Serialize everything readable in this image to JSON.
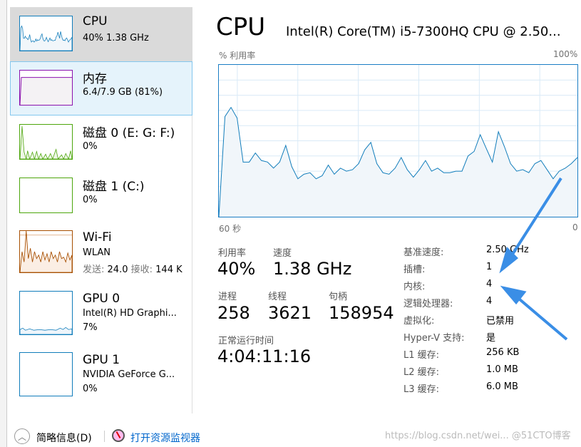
{
  "sidebar": {
    "items": [
      {
        "title": "CPU",
        "sub": "40% 1.38 GHz",
        "color": "#117dbb",
        "state": "selected"
      },
      {
        "title": "内存",
        "sub": "6.4/7.9 GB (81%)",
        "color": "#8b12ae",
        "state": "hover"
      },
      {
        "title": "磁盘 0 (E: G: F:)",
        "sub": "0%",
        "color": "#4da60c"
      },
      {
        "title": "磁盘 1 (C:)",
        "sub": "0%",
        "color": "#4da60c"
      },
      {
        "title": "Wi-Fi",
        "sub": "WLAN",
        "send_label": "发送:",
        "send": "24.0",
        "recv_label": "接收:",
        "recv": "144 K",
        "color": "#a74f01"
      },
      {
        "title": "GPU 0",
        "sub": "Intel(R) HD Graphi...",
        "sub2": "7%",
        "color": "#117dbb"
      },
      {
        "title": "GPU 1",
        "sub": "NVIDIA GeForce G...",
        "sub2": "0%",
        "color": "#117dbb"
      }
    ]
  },
  "main": {
    "title": "CPU",
    "model": "Intel(R) Core(TM) i5-7300HQ CPU @ 2.50...",
    "graph_label": "% 利用率",
    "graph_max": "100%",
    "graph_left": "60 秒",
    "graph_right": "0",
    "stats": {
      "util_label": "利用率",
      "util": "40%",
      "speed_label": "速度",
      "speed": "1.38 GHz",
      "proc_label": "进程",
      "proc": "258",
      "thread_label": "线程",
      "thread": "3621",
      "handle_label": "句柄",
      "handle": "158954",
      "uptime_label": "正常运行时间",
      "uptime": "4:04:11:16"
    },
    "specs": [
      {
        "k": "基准速度:",
        "v": "2.50 GHz"
      },
      {
        "k": "插槽:",
        "v": "1"
      },
      {
        "k": "内核:",
        "v": "4"
      },
      {
        "k": "逻辑处理器:",
        "v": "4"
      },
      {
        "k": "虚拟化:",
        "v": "已禁用"
      },
      {
        "k": "Hyper-V 支持:",
        "v": "是"
      },
      {
        "k": "L1 缓存:",
        "v": "256 KB"
      },
      {
        "k": "L2 缓存:",
        "v": "1.0 MB"
      },
      {
        "k": "L3 缓存:",
        "v": "6.0 MB"
      }
    ]
  },
  "footer": {
    "summary": "简略信息(D)",
    "monitor": "打开资源监视器"
  },
  "watermark": "https://blog.csdn.net/wei... @51CTO博客",
  "chart_data": {
    "type": "area",
    "ylim": [
      0,
      100
    ],
    "xlabel": "60 秒",
    "ylabel": "% 利用率",
    "grid": true,
    "values": [
      0,
      66,
      72,
      65,
      36,
      36,
      42,
      37,
      36,
      32,
      36,
      47,
      33,
      25,
      28,
      29,
      25,
      27,
      34,
      28,
      32,
      30,
      31,
      35,
      44,
      49,
      35,
      29,
      28,
      32,
      39,
      31,
      26,
      31,
      37,
      30,
      32,
      29,
      29,
      30,
      30,
      40,
      43,
      54,
      45,
      36,
      56,
      46,
      35,
      30,
      31,
      29,
      35,
      37,
      31,
      25,
      30,
      32,
      35,
      39
    ]
  },
  "colors": {
    "accent": "#117dbb",
    "annotation": "#3a8ee6"
  }
}
